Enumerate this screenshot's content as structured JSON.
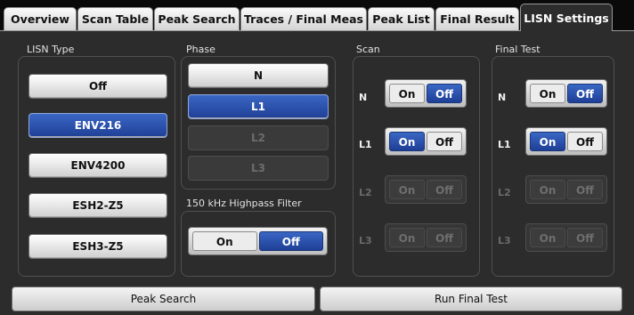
{
  "tabs": [
    {
      "label": "Overview"
    },
    {
      "label": "Scan Table"
    },
    {
      "label": "Peak Search"
    },
    {
      "label": "Traces / Final Meas"
    },
    {
      "label": "Peak List"
    },
    {
      "label": "Final Result"
    },
    {
      "label": "LISN Settings",
      "active": true
    }
  ],
  "lisn_type": {
    "title": "LISN Type",
    "options": [
      "Off",
      "ENV216",
      "ENV4200",
      "ESH2-Z5",
      "ESH3-Z5"
    ],
    "selected": "ENV216"
  },
  "phase": {
    "title": "Phase",
    "options": [
      "N",
      "L1",
      "L2",
      "L3"
    ],
    "selected": "L1",
    "disabled": [
      "L2",
      "L3"
    ]
  },
  "highpass": {
    "title": "150 kHz Highpass Filter",
    "on_label": "On",
    "off_label": "Off",
    "value": "Off"
  },
  "scan": {
    "title": "Scan",
    "rows": [
      {
        "label": "N",
        "value": "Off",
        "enabled": true
      },
      {
        "label": "L1",
        "value": "On",
        "enabled": true
      },
      {
        "label": "L2",
        "value": "Off",
        "enabled": false
      },
      {
        "label": "L3",
        "value": "Off",
        "enabled": false
      }
    ],
    "on_label": "On",
    "off_label": "Off"
  },
  "final_test": {
    "title": "Final Test",
    "rows": [
      {
        "label": "N",
        "value": "Off",
        "enabled": true
      },
      {
        "label": "L1",
        "value": "On",
        "enabled": true
      },
      {
        "label": "L2",
        "value": "Off",
        "enabled": false
      },
      {
        "label": "L3",
        "value": "Off",
        "enabled": false
      }
    ],
    "on_label": "On",
    "off_label": "Off"
  },
  "buttons": {
    "peak_search": "Peak Search",
    "run_final_test": "Run Final Test"
  },
  "colors": {
    "selected_blue": "#2a52b0",
    "panel_bg": "#2c2c2c"
  }
}
